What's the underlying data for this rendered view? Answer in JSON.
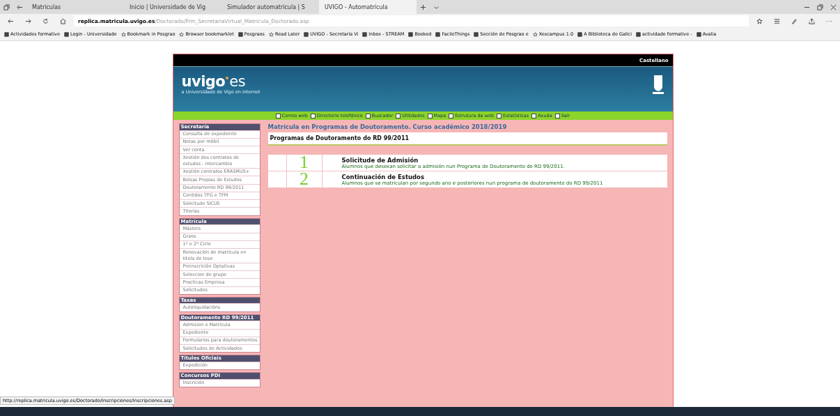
{
  "browser": {
    "tabs": [
      {
        "label": "Matrículas",
        "selected": false
      },
      {
        "label": "Inicio | Universidade de Vig",
        "selected": false
      },
      {
        "label": "Simulador automatrícula | S",
        "selected": false
      },
      {
        "label": "UVIGO - Automatrícula",
        "selected": true
      }
    ],
    "url_host": "replica.matricula.uvigo.es",
    "url_path": "/Doctorado/Frm_SecretariaVirtual_Matricula_Doctorado.asp",
    "bookmarks": [
      {
        "label": "Actividades formative",
        "kind": "site"
      },
      {
        "label": "Login - Universidade",
        "kind": "site"
      },
      {
        "label": "Bookmark in Posgrao",
        "kind": "star"
      },
      {
        "label": "Browser bookmarklet",
        "kind": "star"
      },
      {
        "label": "Posgraos",
        "kind": "site"
      },
      {
        "label": "Read Later",
        "kind": "star"
      },
      {
        "label": "UVIGO - Secretaría Vi",
        "kind": "site"
      },
      {
        "label": "Inbox - STREAM",
        "kind": "site"
      },
      {
        "label": "Booked",
        "kind": "site"
      },
      {
        "label": "FacileThings",
        "kind": "site"
      },
      {
        "label": "Sección de Posgrao e",
        "kind": "site"
      },
      {
        "label": "Xescampus 1.0",
        "kind": "star"
      },
      {
        "label": "A Biblioteca de Galici",
        "kind": "site"
      },
      {
        "label": "actividade formative -",
        "kind": "site"
      },
      {
        "label": "Avalia",
        "kind": "site"
      }
    ],
    "status_url": "http://replica.matricula.uvigo.es/Doctorado/Inscripciones/Inscripciones.asp"
  },
  "page": {
    "language": "Castellano",
    "logo": "uvigo",
    "logo_suffix": "es",
    "tagline": "a Universidade de Vigo en internet",
    "nav": [
      "Correo web",
      "Directorio telefónico",
      "Buscador",
      "Utilidades",
      "Mapa",
      "Estrutura da web",
      "Estatísticas",
      "Axuda",
      "Saír"
    ],
    "sidebar": [
      {
        "title": "Secretaría",
        "items": [
          "Consulta de expediente",
          "Notas por móbil",
          "Ver conta",
          "Xestión dos contratos de estudos - Intercambio",
          "Xestión contratos ERASMUS+",
          "Bolsas Propias de Estudos",
          "Doutoramento RD 99/2011",
          "Contidos TFG e TFM",
          "Solicitude SICUE",
          "Titorías"
        ]
      },
      {
        "title": "Matrícula",
        "items": [
          "Másters",
          "Graos",
          "1º e 2º Ciclo",
          "Renovación de matrícula en titela de tese",
          "Preinscrición Optativas",
          "Seleccion de grupo",
          "Practicas Empresa",
          "Solicitudes"
        ]
      },
      {
        "title": "Taxas",
        "items": [
          "Autoliquidacións"
        ]
      },
      {
        "title": "Doutoramento RD 99/2011",
        "items": [
          "Admision e Matrícula",
          "Expediente",
          "Formularios para doutoramentos",
          "Solicitudes de Actividades"
        ]
      },
      {
        "title": "Títulos Oficiais",
        "items": [
          "Expedición"
        ]
      },
      {
        "title": "Concursos PDI",
        "items": [
          "Inscrición"
        ]
      }
    ],
    "title": "Matrícula en Programas de Doutoramento. Curso académico 2018/2019",
    "section_title": "Programas de Doutoramento do RD 99/2011",
    "options": [
      {
        "number": "1",
        "title": "Solicitude de Admisión",
        "description": "Alumnos que desexan solicitar a admisión nun Programa de Doutoramento do RD 99/2011."
      },
      {
        "number": "2",
        "title": "Continuación de Estudos",
        "description": "Alumnos que se matriculan por segundo ano e posteriores nun programa de doutoramento do RD 99/2011"
      }
    ]
  }
}
